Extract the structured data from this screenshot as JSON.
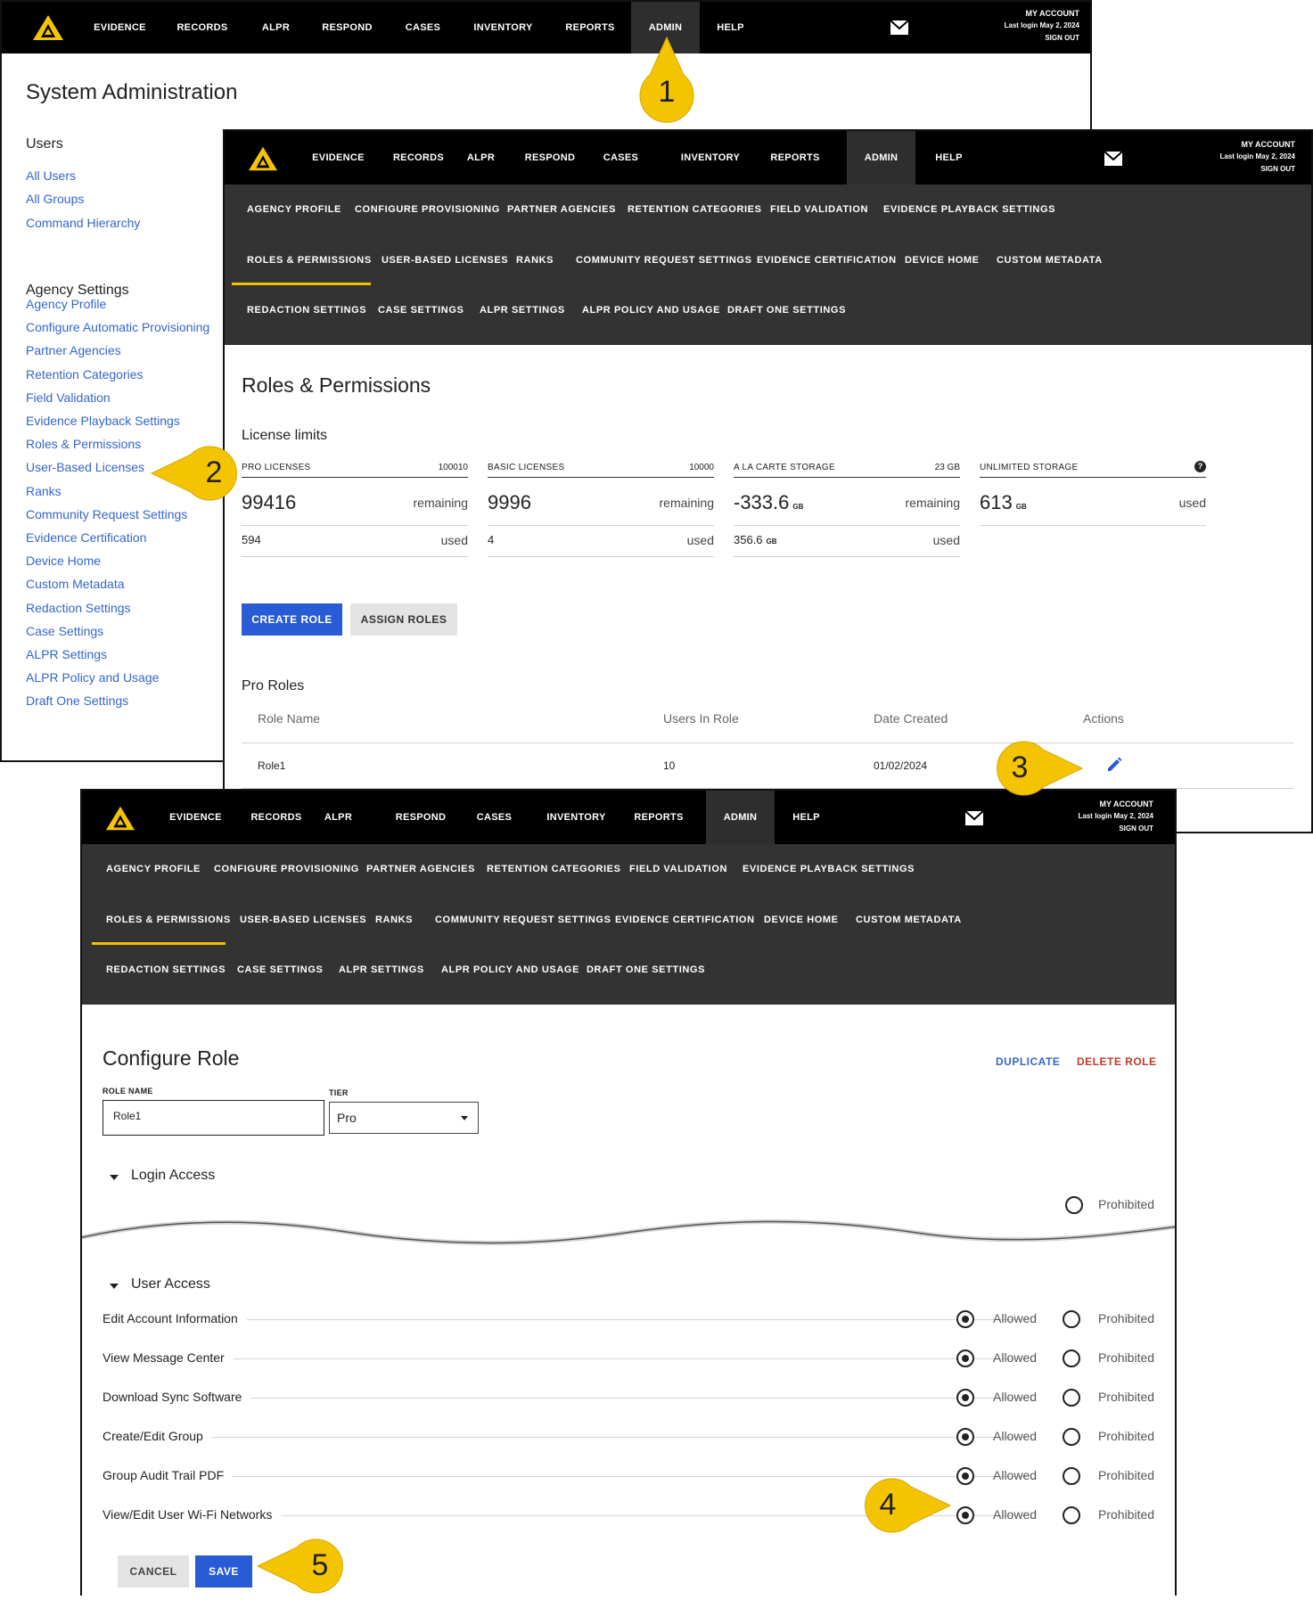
{
  "nav": {
    "items": [
      "EVIDENCE",
      "RECORDS",
      "ALPR",
      "RESPOND",
      "CASES",
      "INVENTORY",
      "REPORTS",
      "ADMIN",
      "HELP"
    ],
    "active": "ADMIN",
    "account": {
      "my_account": "MY ACCOUNT",
      "last_login": "Last login May 2, 2024",
      "sign_out": "SIGN OUT"
    }
  },
  "admin_page": {
    "title": "System Administration",
    "users_heading": "Users",
    "users_links": [
      "All Users",
      "All Groups",
      "Command Hierarchy"
    ],
    "agency_heading": "Agency Settings",
    "agency_links": [
      "Agency Profile",
      "Configure Automatic Provisioning",
      "Partner Agencies",
      "Retention Categories",
      "Field Validation",
      "Evidence Playback Settings",
      "Roles & Permissions",
      "User-Based Licenses",
      "Ranks",
      "Community Request Settings",
      "Evidence Certification",
      "Device Home",
      "Custom Metadata",
      "Redaction Settings",
      "Case Settings",
      "ALPR Settings",
      "ALPR Policy and Usage",
      "Draft One Settings"
    ]
  },
  "subnav": {
    "row1": [
      "AGENCY PROFILE",
      "CONFIGURE PROVISIONING",
      "PARTNER AGENCIES",
      "RETENTION CATEGORIES",
      "FIELD VALIDATION",
      "EVIDENCE PLAYBACK SETTINGS"
    ],
    "row2": [
      "ROLES & PERMISSIONS",
      "USER-BASED LICENSES",
      "RANKS",
      "COMMUNITY REQUEST SETTINGS",
      "EVIDENCE CERTIFICATION",
      "DEVICE HOME",
      "CUSTOM METADATA"
    ],
    "row3": [
      "REDACTION SETTINGS",
      "CASE SETTINGS",
      "ALPR SETTINGS",
      "ALPR POLICY AND USAGE",
      "DRAFT ONE SETTINGS"
    ]
  },
  "roles_page": {
    "title": "Roles & Permissions",
    "license_heading": "License limits",
    "licenses": [
      {
        "label": "PRO LICENSES",
        "limit": "100010",
        "main": "99416",
        "main_unit": "",
        "main_status": "remaining",
        "sub": "594",
        "sub_unit": "",
        "sub_status": "used"
      },
      {
        "label": "BASIC LICENSES",
        "limit": "10000",
        "main": "9996",
        "main_unit": "",
        "main_status": "remaining",
        "sub": "4",
        "sub_unit": "",
        "sub_status": "used"
      },
      {
        "label": "A LA CARTE STORAGE",
        "limit": "23 GB",
        "main": "-333.6",
        "main_unit": "GB",
        "main_status": "remaining",
        "sub": "356.6",
        "sub_unit": "GB",
        "sub_status": "used"
      },
      {
        "label": "UNLIMITED STORAGE",
        "limit": "?",
        "main": "613",
        "main_unit": "GB",
        "main_status": "used",
        "sub": "",
        "sub_unit": "",
        "sub_status": ""
      }
    ],
    "create_role": "CREATE ROLE",
    "assign_roles": "ASSIGN ROLES",
    "pro_roles_heading": "Pro Roles",
    "table_headers": [
      "Role Name",
      "Users In Role",
      "Date Created",
      "Actions"
    ],
    "rows": [
      {
        "name": "Role1",
        "users": "10",
        "created": "01/02/2024"
      }
    ]
  },
  "configure": {
    "title": "Configure Role",
    "duplicate": "DUPLICATE",
    "delete_role": "DELETE ROLE",
    "role_name_label": "ROLE NAME",
    "role_name_value": "Role1",
    "tier_label": "TIER",
    "tier_value": "Pro",
    "login_access": "Login Access",
    "prohibited_partial": "Prohibited",
    "user_access": "User Access",
    "allowed": "Allowed",
    "prohibited": "Prohibited",
    "permissions": [
      "Edit Account Information",
      "View Message Center",
      "Download Sync Software",
      "Create/Edit Group",
      "Group Audit Trail PDF",
      "View/Edit User Wi-Fi Networks"
    ],
    "cancel": "CANCEL",
    "save": "SAVE"
  },
  "callouts": [
    "1",
    "2",
    "3",
    "4",
    "5"
  ],
  "colors": {
    "accent_yellow": "#f5c400",
    "link_blue": "#3366cc",
    "primary_button": "#2a5bd7",
    "delete_red": "#c0392b",
    "subnav_bg": "#333333"
  }
}
